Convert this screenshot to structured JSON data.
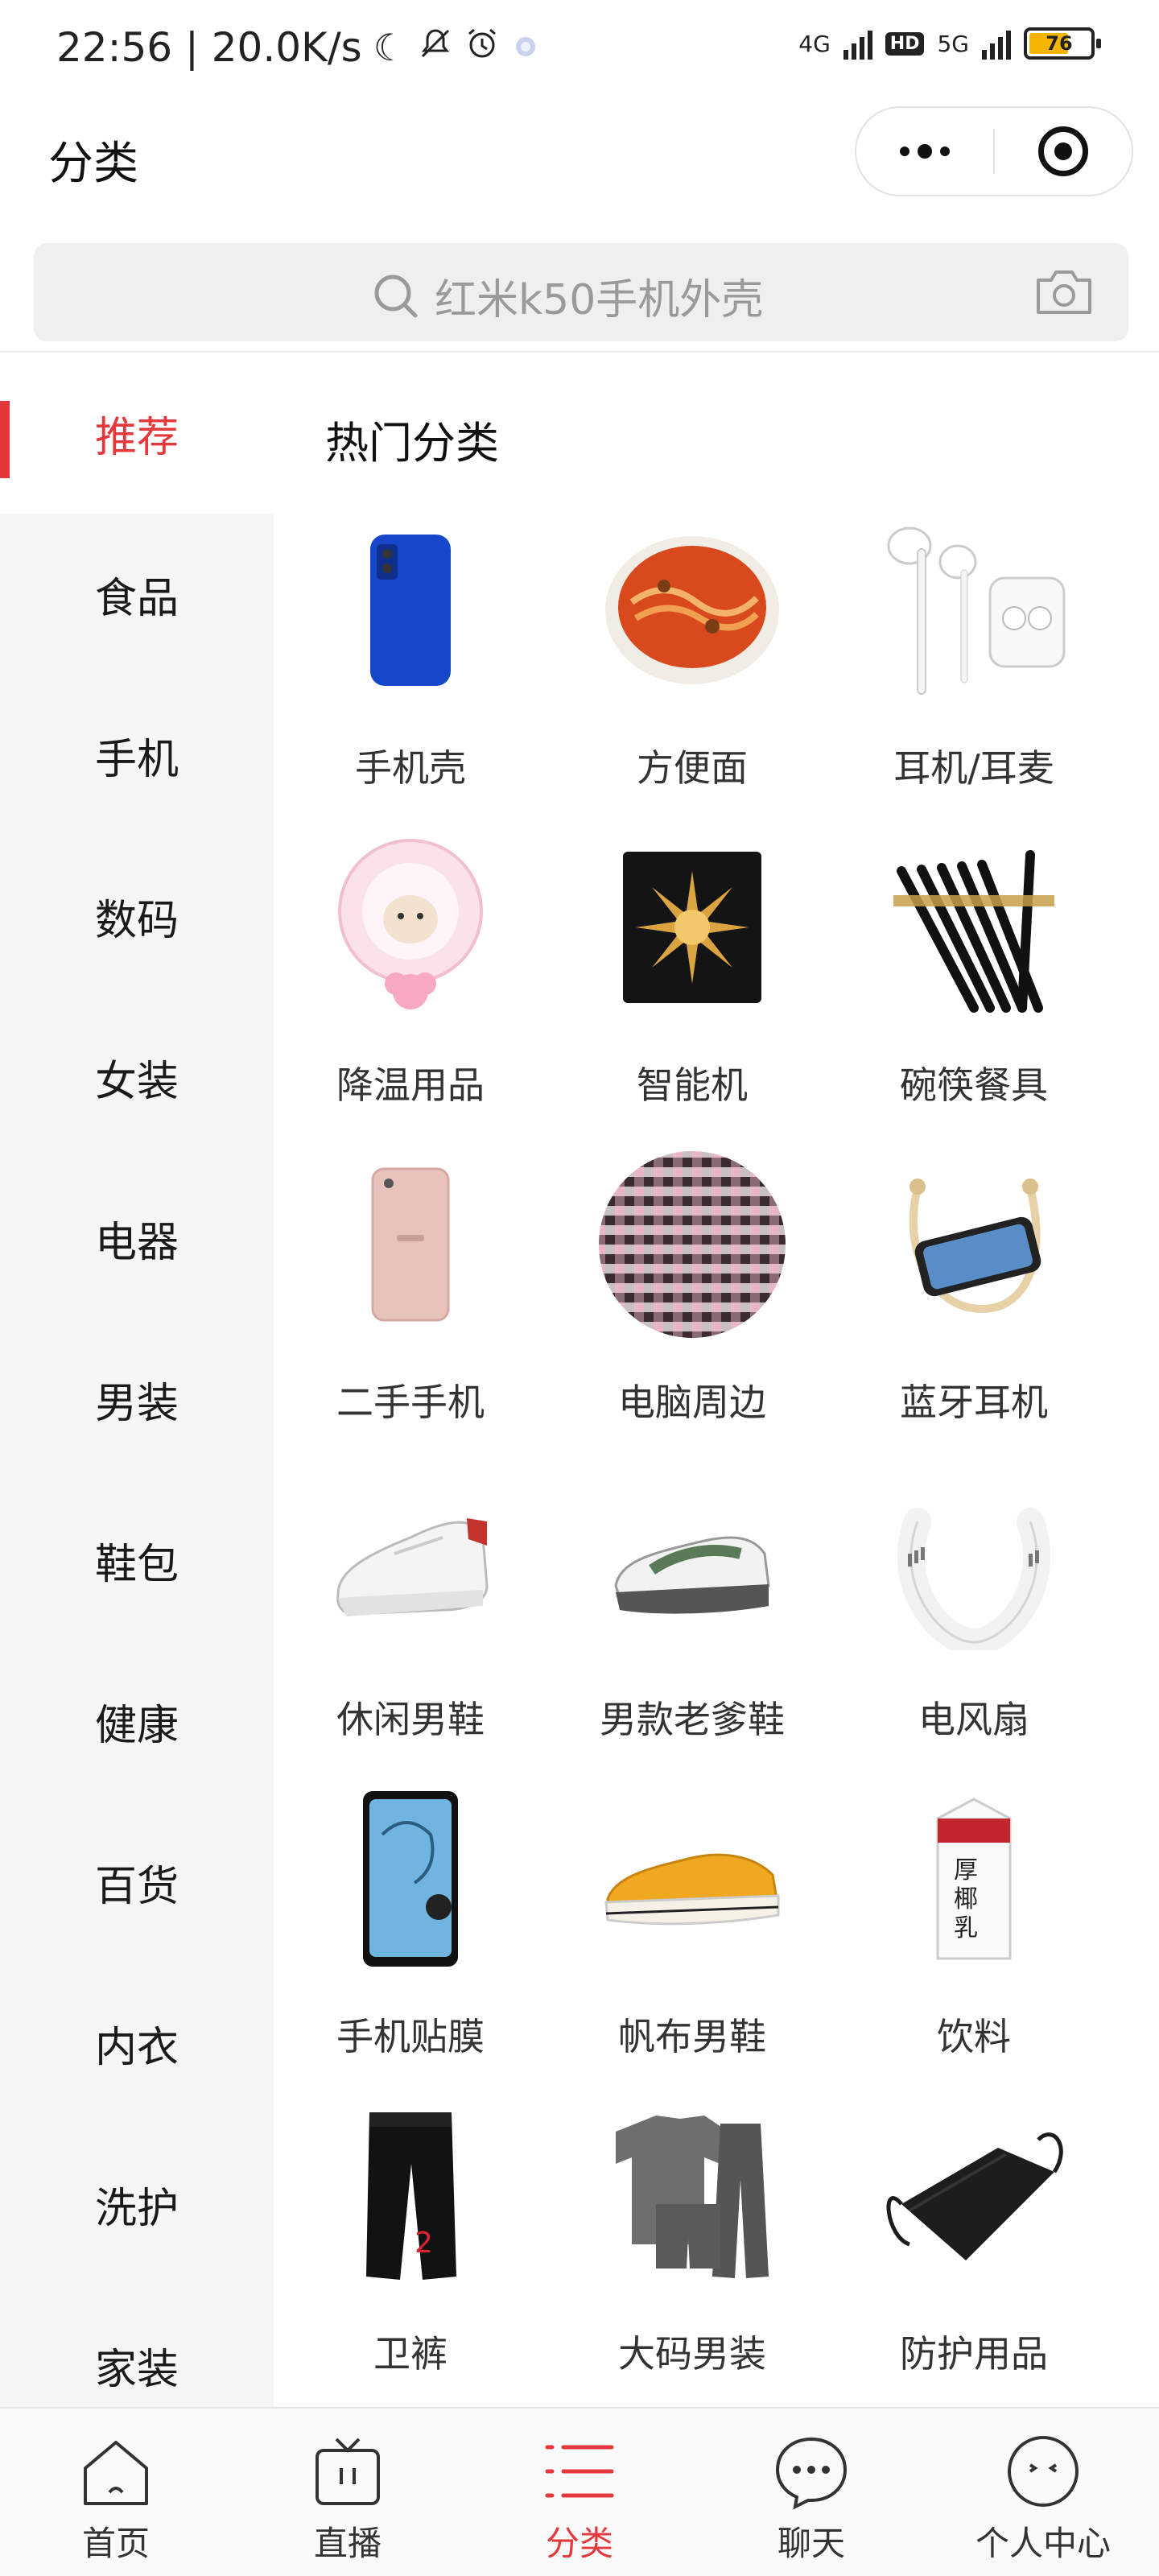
{
  "status_bar": {
    "time_speed": "22:56 | 20.0K/s",
    "network_1": "4G",
    "hd": "HD",
    "network_2": "5G",
    "battery": "76"
  },
  "header": {
    "title": "分类"
  },
  "search": {
    "placeholder": "红米k50手机外壳"
  },
  "sidebar": {
    "items": [
      {
        "label": "推荐",
        "active": true
      },
      {
        "label": "食品"
      },
      {
        "label": "手机"
      },
      {
        "label": "数码"
      },
      {
        "label": "女装"
      },
      {
        "label": "电器"
      },
      {
        "label": "男装"
      },
      {
        "label": "鞋包"
      },
      {
        "label": "健康"
      },
      {
        "label": "百货"
      },
      {
        "label": "内衣"
      },
      {
        "label": "洗护"
      },
      {
        "label": "家装"
      }
    ]
  },
  "main": {
    "section_title": "热门分类",
    "categories": [
      {
        "label": "手机壳",
        "icon": "phone-case-icon"
      },
      {
        "label": "方便面",
        "icon": "noodle-bowl-icon"
      },
      {
        "label": "耳机/耳麦",
        "icon": "earphones-icon"
      },
      {
        "label": "降温用品",
        "icon": "cooling-fan-icon"
      },
      {
        "label": "智能机",
        "icon": "foldable-phone-icon"
      },
      {
        "label": "碗筷餐具",
        "icon": "chopsticks-icon"
      },
      {
        "label": "二手手机",
        "icon": "used-phone-icon"
      },
      {
        "label": "电脑周边",
        "icon": "sticker-collage-icon"
      },
      {
        "label": "蓝牙耳机",
        "icon": "neckband-earphones-icon"
      },
      {
        "label": "休闲男鞋",
        "icon": "casual-shoe-icon"
      },
      {
        "label": "男款老爹鞋",
        "icon": "dad-shoe-icon"
      },
      {
        "label": "电风扇",
        "icon": "neck-fan-icon"
      },
      {
        "label": "手机贴膜",
        "icon": "screen-protector-icon"
      },
      {
        "label": "帆布男鞋",
        "icon": "canvas-shoe-icon"
      },
      {
        "label": "饮料",
        "icon": "drink-carton-icon"
      },
      {
        "label": "卫裤",
        "icon": "sweatpants-icon"
      },
      {
        "label": "大码男装",
        "icon": "mens-set-icon"
      },
      {
        "label": "防护用品",
        "icon": "face-mask-icon"
      }
    ]
  },
  "tabbar": {
    "items": [
      {
        "label": "首页",
        "icon": "home-icon"
      },
      {
        "label": "直播",
        "icon": "live-tv-icon"
      },
      {
        "label": "分类",
        "icon": "category-list-icon",
        "active": true
      },
      {
        "label": "聊天",
        "icon": "chat-bubble-icon"
      },
      {
        "label": "个人中心",
        "icon": "profile-face-icon"
      }
    ]
  },
  "colors": {
    "accent": "#e4393c",
    "sidebar_bg": "#f6f6f6",
    "search_bg": "#efefef"
  }
}
